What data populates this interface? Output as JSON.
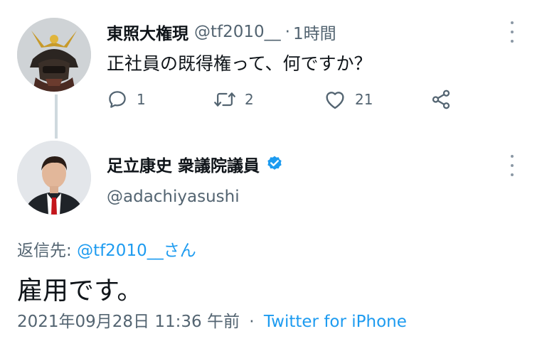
{
  "tweet1": {
    "display_name": "東照大権現",
    "handle": "@tf2010__",
    "separator": "·",
    "time": "1時間",
    "text": "正社員の既得権って、何ですか？",
    "actions": {
      "reply_count": "1",
      "retweet_count": "2",
      "like_count": "21"
    }
  },
  "tweet2": {
    "display_name": "足立康史 衆議院議員",
    "handle": "@adachiyasushi",
    "reply_prefix": "返信先: ",
    "reply_target": "@tf2010__さん",
    "text": "雇用です。",
    "datetime": "2021年09月28日 11:36 午前",
    "separator": "·",
    "source": "Twitter for iPhone"
  },
  "icons": {
    "reply": "reply-icon",
    "retweet": "retweet-icon",
    "like": "heart-icon",
    "share": "share-icon",
    "verified": "verified-badge-icon",
    "more": "more-options-icon"
  },
  "colors": {
    "accent": "#1d9bf0",
    "secondary_text": "#536471",
    "primary_text": "#0f1419"
  }
}
